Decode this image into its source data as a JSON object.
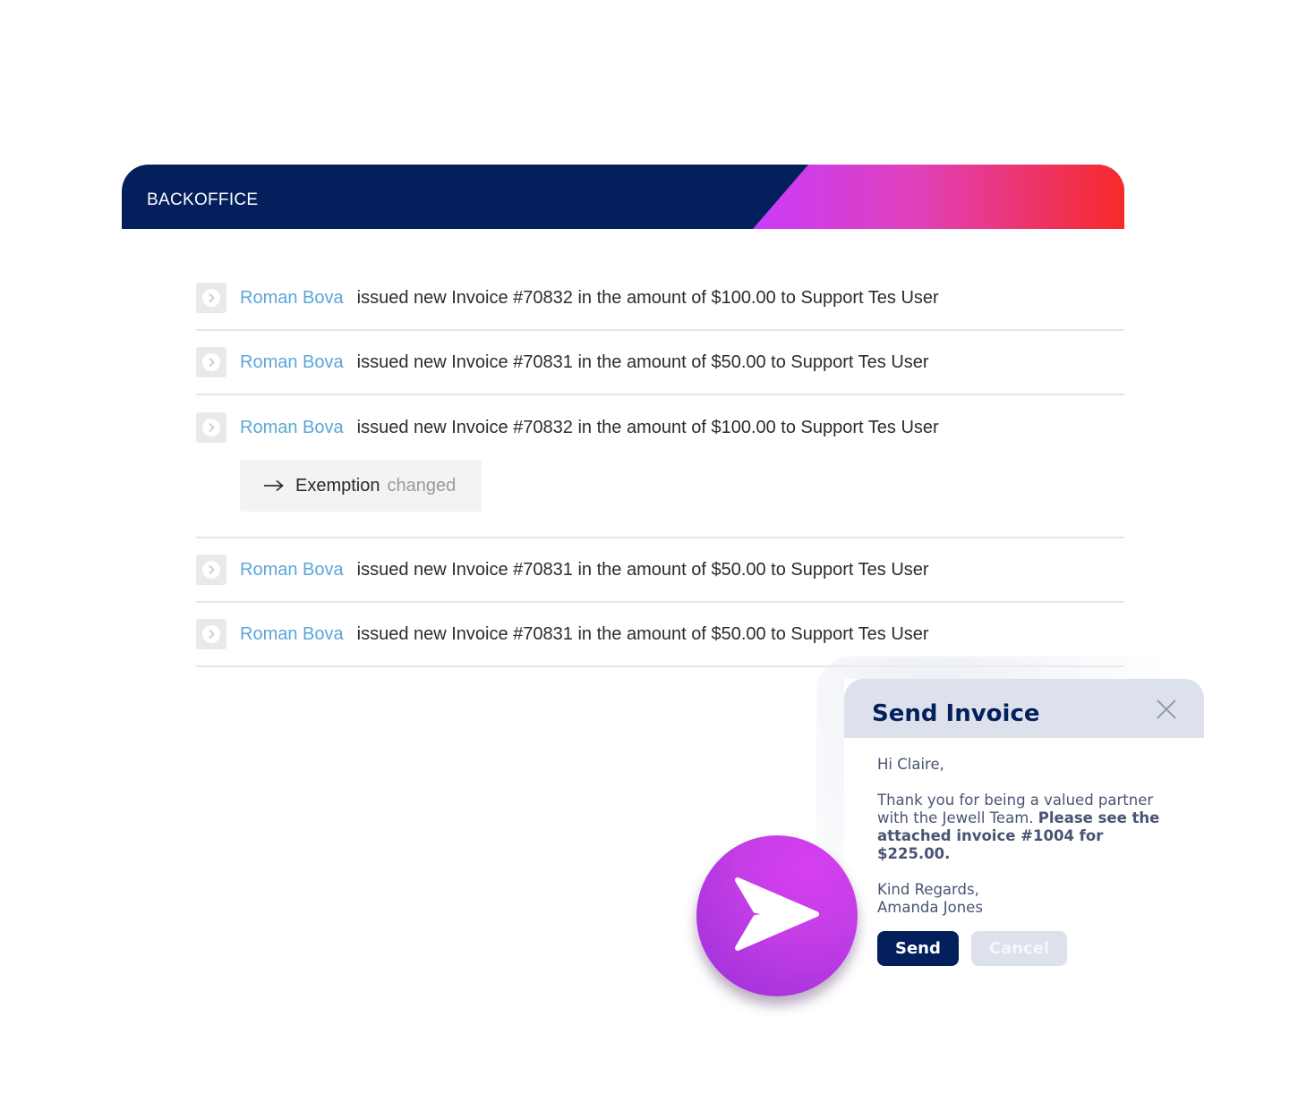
{
  "header": {
    "title": "BACKOFFICE"
  },
  "feed": {
    "rows": [
      {
        "user": "Roman Bova",
        "text": "issued new Invoice #70832 in the amount of $100.00 to Support Tes User"
      },
      {
        "user": "Roman Bova",
        "text": "issued new Invoice #70831 in the amount of $50.00 to Support Tes User"
      },
      {
        "user": "Roman Bova",
        "text": "issued new Invoice #70832 in the amount of $100.00 to Support Tes User",
        "change": {
          "label": "Exemption",
          "status": "changed"
        }
      },
      {
        "user": "Roman Bova",
        "text": "issued new Invoice #70831 in the amount of $50.00 to Support Tes User"
      },
      {
        "user": "Roman Bova",
        "text": "issued new Invoice #70831 in the amount of $50.00 to Support Tes User"
      }
    ]
  },
  "modal": {
    "title": "Send Invoice",
    "greeting": "Hi Claire,",
    "body_plain": "Thank you for being a valued partner with the Jewell Team.",
    "body_bold": "Please see the attached invoice #1004 for $225.00.",
    "signoff": "Kind Regards,",
    "signature": "Amanda Jones",
    "send_label": "Send",
    "cancel_label": "Cancel"
  },
  "icons": {
    "row_icon": "chevron-right-circle-icon",
    "close": "close-icon",
    "send": "paper-plane-icon"
  },
  "colors": {
    "navy": "#04205c",
    "link": "#5aa7d8",
    "gradient_start": "#c83cfb",
    "gradient_end": "#f72a2a"
  }
}
